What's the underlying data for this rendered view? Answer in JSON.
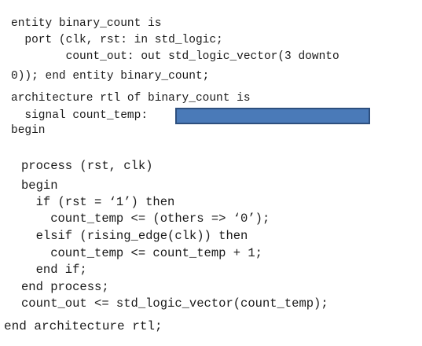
{
  "entity_block": {
    "line1": "entity binary_count is",
    "line2": "  port (clk, rst: in std_logic;",
    "line3": "        count_out: out std_logic_vector(3 downto",
    "line4": "0)); end entity binary_count;"
  },
  "architecture_block": {
    "line1": "architecture rtl of binary_count is",
    "line2": "  signal count_temp:",
    "line3": "begin"
  },
  "process_block": {
    "line1": "process (rst, clk)",
    "line2": "begin",
    "line3": "  if (rst = ‘1’) then",
    "line4": "    count_temp <= (others => ‘0’);",
    "line5": "  elsif (rising_edge(clk)) then",
    "line6": "    count_temp <= count_temp + 1;",
    "line7": "  end if;",
    "line8": "end process;",
    "line9": "count_out <= std_logic_vector(count_temp);"
  },
  "closing": {
    "line1": "end architecture rtl;"
  },
  "colors": {
    "blank_fill": "#4a7ab8",
    "blank_border": "#2d4f7e"
  }
}
